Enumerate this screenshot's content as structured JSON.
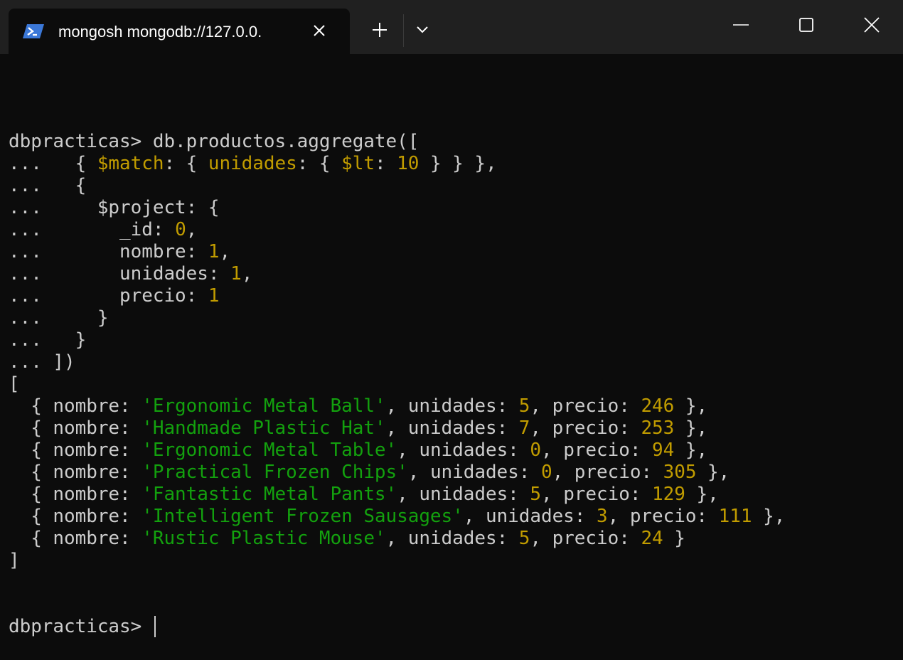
{
  "tab": {
    "title": "mongosh mongodb://127.0.0.",
    "icon": "powershell-icon"
  },
  "colors": {
    "background": "#0c0c0c",
    "text": "#cccccc",
    "number": "#c19c00",
    "string": "#13a10e",
    "titlebar": "#202020"
  },
  "terminal": {
    "lines": [
      [
        {
          "t": "dbpracticas> db.productos.aggregate(["
        }
      ],
      [
        {
          "t": "...   { "
        },
        {
          "t": "$match",
          "c": "y"
        },
        {
          "t": ": { "
        },
        {
          "t": "unidades",
          "c": "y"
        },
        {
          "t": ": { "
        },
        {
          "t": "$lt",
          "c": "y"
        },
        {
          "t": ": "
        },
        {
          "t": "10",
          "c": "y"
        },
        {
          "t": " } } },"
        }
      ],
      [
        {
          "t": "...   {"
        }
      ],
      [
        {
          "t": "...     $project: {"
        }
      ],
      [
        {
          "t": "...       _id: "
        },
        {
          "t": "0",
          "c": "y"
        },
        {
          "t": ","
        }
      ],
      [
        {
          "t": "...       nombre: "
        },
        {
          "t": "1",
          "c": "y"
        },
        {
          "t": ","
        }
      ],
      [
        {
          "t": "...       unidades: "
        },
        {
          "t": "1",
          "c": "y"
        },
        {
          "t": ","
        }
      ],
      [
        {
          "t": "...       precio: "
        },
        {
          "t": "1",
          "c": "y"
        }
      ],
      [
        {
          "t": "...     }"
        }
      ],
      [
        {
          "t": "...   }"
        }
      ],
      [
        {
          "t": "... ])"
        }
      ],
      [
        {
          "t": "["
        }
      ],
      [
        {
          "t": "  { nombre: "
        },
        {
          "t": "'Ergonomic Metal Ball'",
          "c": "g"
        },
        {
          "t": ", unidades: "
        },
        {
          "t": "5",
          "c": "y"
        },
        {
          "t": ", precio: "
        },
        {
          "t": "246",
          "c": "y"
        },
        {
          "t": " },"
        }
      ],
      [
        {
          "t": "  { nombre: "
        },
        {
          "t": "'Handmade Plastic Hat'",
          "c": "g"
        },
        {
          "t": ", unidades: "
        },
        {
          "t": "7",
          "c": "y"
        },
        {
          "t": ", precio: "
        },
        {
          "t": "253",
          "c": "y"
        },
        {
          "t": " },"
        }
      ],
      [
        {
          "t": "  { nombre: "
        },
        {
          "t": "'Ergonomic Metal Table'",
          "c": "g"
        },
        {
          "t": ", unidades: "
        },
        {
          "t": "0",
          "c": "y"
        },
        {
          "t": ", precio: "
        },
        {
          "t": "94",
          "c": "y"
        },
        {
          "t": " },"
        }
      ],
      [
        {
          "t": "  { nombre: "
        },
        {
          "t": "'Practical Frozen Chips'",
          "c": "g"
        },
        {
          "t": ", unidades: "
        },
        {
          "t": "0",
          "c": "y"
        },
        {
          "t": ", precio: "
        },
        {
          "t": "305",
          "c": "y"
        },
        {
          "t": " },"
        }
      ],
      [
        {
          "t": "  { nombre: "
        },
        {
          "t": "'Fantastic Metal Pants'",
          "c": "g"
        },
        {
          "t": ", unidades: "
        },
        {
          "t": "5",
          "c": "y"
        },
        {
          "t": ", precio: "
        },
        {
          "t": "129",
          "c": "y"
        },
        {
          "t": " },"
        }
      ],
      [
        {
          "t": "  { nombre: "
        },
        {
          "t": "'Intelligent Frozen Sausages'",
          "c": "g"
        },
        {
          "t": ", unidades: "
        },
        {
          "t": "3",
          "c": "y"
        },
        {
          "t": ", precio: "
        },
        {
          "t": "111",
          "c": "y"
        },
        {
          "t": " },"
        }
      ],
      [
        {
          "t": "  { nombre: "
        },
        {
          "t": "'Rustic Plastic Mouse'",
          "c": "g"
        },
        {
          "t": ", unidades: "
        },
        {
          "t": "5",
          "c": "y"
        },
        {
          "t": ", precio: "
        },
        {
          "t": "24",
          "c": "y"
        },
        {
          "t": " }"
        }
      ],
      [
        {
          "t": "]"
        }
      ]
    ],
    "prompt": "dbpracticas> "
  }
}
